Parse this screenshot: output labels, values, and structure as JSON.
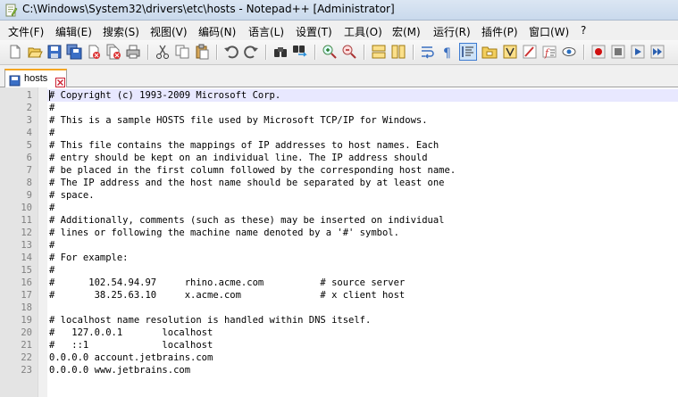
{
  "window": {
    "title": "C:\\Windows\\System32\\drivers\\etc\\hosts - Notepad++ [Administrator]"
  },
  "menu": [
    {
      "label": "文件(F)"
    },
    {
      "label": "编辑(E)"
    },
    {
      "label": "搜索(S)"
    },
    {
      "label": "视图(V)"
    },
    {
      "label": "编码(N)"
    },
    {
      "label": "语言(L)"
    },
    {
      "label": "设置(T)"
    },
    {
      "label": "工具(O)"
    },
    {
      "label": "宏(M)"
    },
    {
      "label": "运行(R)"
    },
    {
      "label": "插件(P)"
    },
    {
      "label": "窗口(W)"
    },
    {
      "label": "?"
    }
  ],
  "toolbar": {
    "icons": [
      "new-file-icon",
      "open-file-icon",
      "save-icon",
      "save-all-icon",
      "close-icon",
      "close-all-icon",
      "print-icon",
      "cut-icon",
      "copy-icon",
      "paste-icon",
      "undo-icon",
      "redo-icon",
      "find-icon",
      "replace-icon",
      "zoom-in-icon",
      "zoom-out-icon",
      "sync-vertical-icon",
      "sync-horizontal-icon",
      "word-wrap-icon",
      "show-all-chars-icon",
      "indent-guide-icon",
      "folder-icon",
      "user-defined-language-icon",
      "document-map-icon",
      "function-list-icon",
      "monitoring-icon",
      "record-macro-icon",
      "stop-record-icon",
      "play-macro-icon",
      "run-macro-multiple-icon"
    ]
  },
  "tab": {
    "label": "hosts",
    "active": true
  },
  "editor": {
    "current_line": 1,
    "lines": [
      "# Copyright (c) 1993-2009 Microsoft Corp.",
      "#",
      "# This is a sample HOSTS file used by Microsoft TCP/IP for Windows.",
      "#",
      "# This file contains the mappings of IP addresses to host names. Each",
      "# entry should be kept on an individual line. The IP address should",
      "# be placed in the first column followed by the corresponding host name.",
      "# The IP address and the host name should be separated by at least one",
      "# space.",
      "#",
      "# Additionally, comments (such as these) may be inserted on individual",
      "# lines or following the machine name denoted by a '#' symbol.",
      "#",
      "# For example:",
      "#",
      "#      102.54.94.97     rhino.acme.com          # source server",
      "#       38.25.63.10     x.acme.com              # x client host",
      "",
      "# localhost name resolution is handled within DNS itself.",
      "#   127.0.0.1       localhost",
      "#   ::1             localhost",
      "0.0.0.0 account.jetbrains.com",
      "0.0.0.0 www.jetbrains.com"
    ]
  },
  "colors": {
    "tab_accent": "#f5a623",
    "current_line": "#e8e8ff",
    "gutter": "#e4e4e4"
  }
}
